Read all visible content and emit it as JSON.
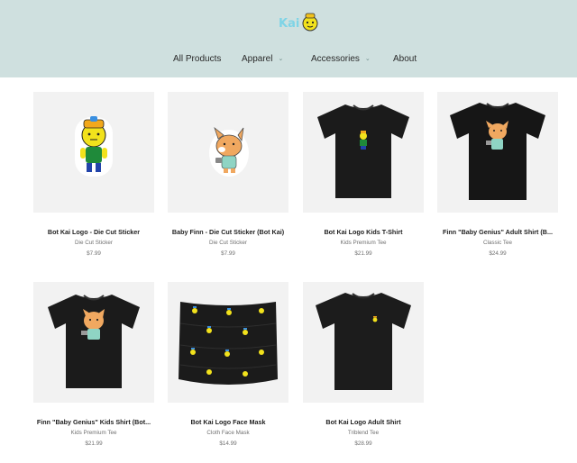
{
  "brand": {
    "logo_icon": "bot-kai-logo",
    "colors": {
      "header_bg": "#cfe0df",
      "tile_bg": "#f2f2f2"
    }
  },
  "nav": {
    "items": [
      {
        "label": "All Products"
      },
      {
        "label": "Apparel",
        "icon": "chevron-down-icon"
      },
      {
        "label": "Accessories",
        "icon": "chevron-down-icon"
      },
      {
        "label": "About"
      }
    ]
  },
  "products": [
    {
      "title": "Bot Kai Logo - Die Cut Sticker",
      "type": "Die Cut Sticker",
      "price": "$7.99"
    },
    {
      "title": "Baby Finn - Die Cut Sticker (Bot Kai)",
      "type": "Die Cut Sticker",
      "price": "$7.99"
    },
    {
      "title": "Bot Kai Logo Kids T-Shirt",
      "type": "Kids Premium Tee",
      "price": "$21.99"
    },
    {
      "title": "Finn \"Baby Genius\" Adult Shirt (B...",
      "type": "Classic Tee",
      "price": "$24.99"
    },
    {
      "title": "Finn \"Baby Genius\" Kids Shirt (Bot...",
      "type": "Kids Premium Tee",
      "price": "$21.99"
    },
    {
      "title": "Bot Kai Logo Face Mask",
      "type": "Cloth Face Mask",
      "price": "$14.99"
    },
    {
      "title": "Bot Kai Logo Adult Shirt",
      "type": "Triblend Tee",
      "price": "$28.99"
    }
  ]
}
